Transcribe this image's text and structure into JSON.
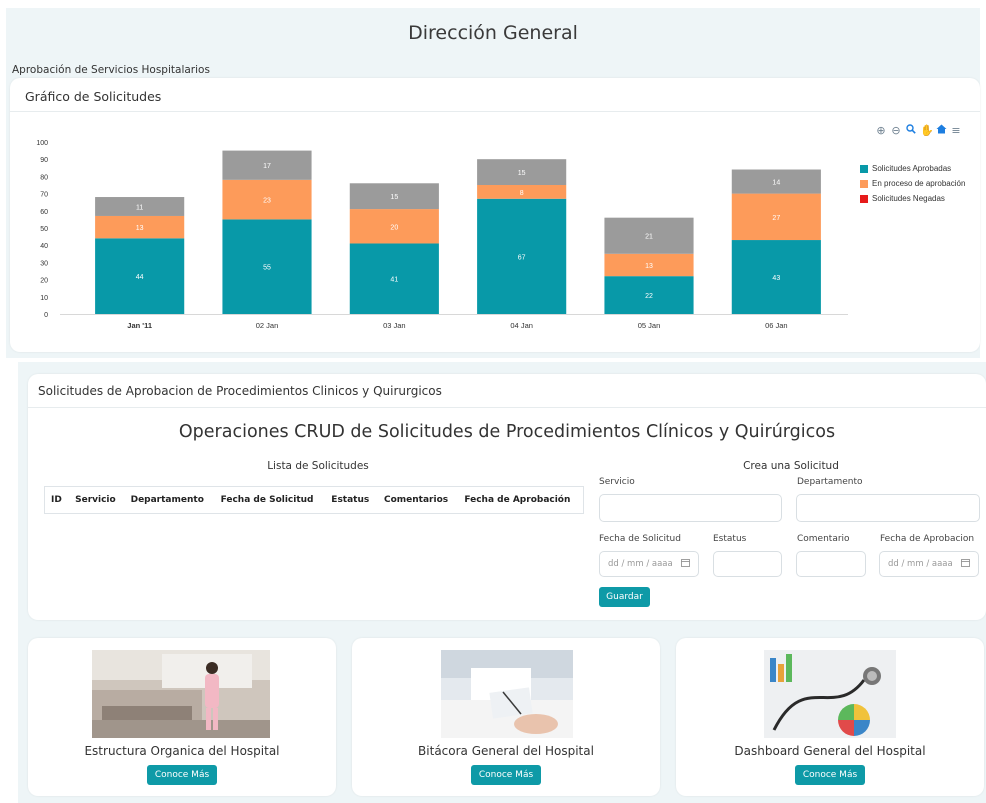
{
  "page": {
    "title": "Dirección General",
    "section_label": "Aprobación de Servicios Hospitalarios"
  },
  "chart_card": {
    "title": "Gráfico de Solicitudes"
  },
  "toolbar": {
    "icons": [
      "zoom-in-icon",
      "zoom-out-icon",
      "magnifier-icon",
      "pan-hand-icon",
      "home-icon",
      "menu-icon"
    ]
  },
  "chart_data": {
    "type": "bar",
    "stacked": true,
    "categories": [
      "Jan '11",
      "02 Jan",
      "03 Jan",
      "04 Jan",
      "05 Jan",
      "06 Jan"
    ],
    "series": [
      {
        "name": "Solicitudes Aprobadas",
        "values": [
          44,
          55,
          41,
          67,
          22,
          43
        ],
        "color": "#0899a8"
      },
      {
        "name": "En proceso de aprobación",
        "values": [
          13,
          23,
          20,
          8,
          13,
          27
        ],
        "color": "#fd9b5a"
      },
      {
        "name": "Solicitudes Negadas",
        "values": [
          11,
          17,
          15,
          15,
          21,
          14
        ],
        "color": "#9b9b9b",
        "legend_color": "#e61b1b"
      }
    ],
    "ylim": [
      0,
      100
    ],
    "yticks": [
      0,
      10,
      20,
      30,
      40,
      50,
      60,
      70,
      80,
      90,
      100
    ],
    "data_label_color": "#ffffff",
    "grid": false,
    "legend": "right"
  },
  "crud": {
    "header": "Solicitudes de Aprobacion de Procedimientos Clinicos y Quirurgicos",
    "title": "Operaciones CRUD de Solicitudes de Procedimientos Clínicos y Quirúrgicos",
    "list_title": "Lista de Solicitudes",
    "columns": [
      "ID",
      "Servicio",
      "Departamento",
      "Fecha de Solicitud",
      "Estatus",
      "Comentarios",
      "Fecha de Aprobación"
    ],
    "form": {
      "title": "Crea una Solicitud",
      "servicio_label": "Servicio",
      "departamento_label": "Departamento",
      "fecha_solicitud_label": "Fecha de Solicitud",
      "estatus_label": "Estatus",
      "comentario_label": "Comentario",
      "fecha_aprobacion_label": "Fecha de Aprobacion",
      "date_placeholder": "dd / mm / aaaa",
      "save_label": "Guardar"
    }
  },
  "cards": [
    {
      "title": "Estructura Organica del Hospital",
      "button": "Conoce Más"
    },
    {
      "title": "Bitácora General del Hospital",
      "button": "Conoce Más"
    },
    {
      "title": "Dashboard General del Hospital",
      "button": "Conoce Más"
    }
  ],
  "colors": {
    "accent": "#0e9aa7",
    "band": "#eef5f7"
  }
}
